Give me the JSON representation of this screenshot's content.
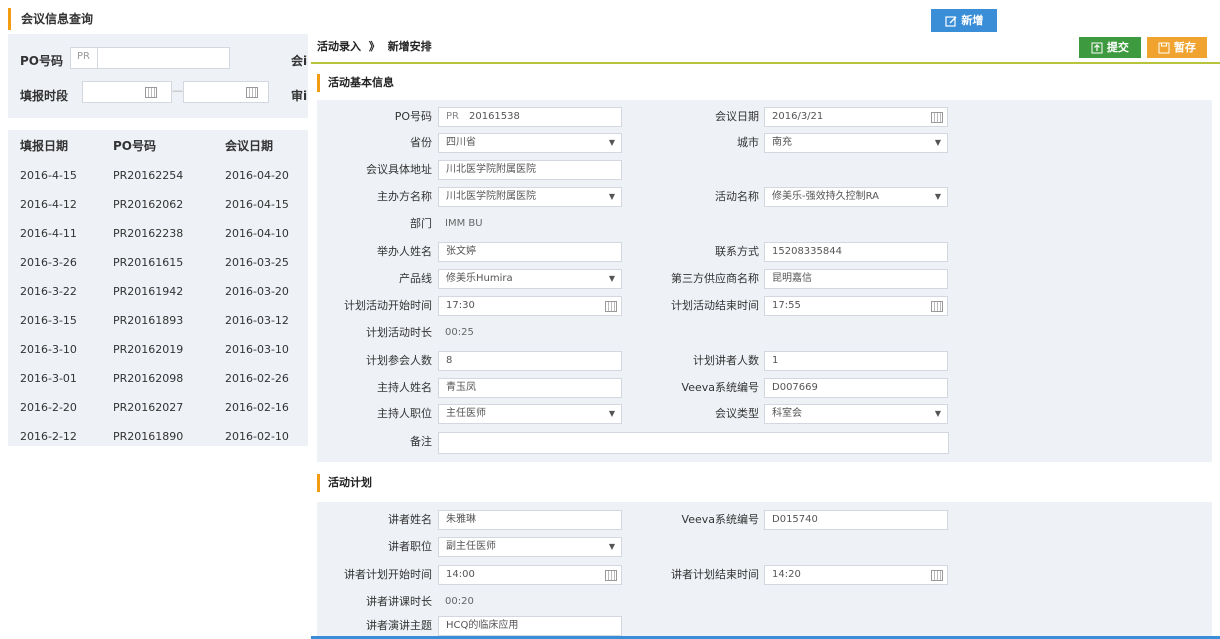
{
  "bg": {
    "title": "会议信息查询",
    "new_button": "新增",
    "filters": {
      "po_label": "PO号码",
      "po_prefix": "PR",
      "meeting_label_partial": "会i",
      "period_label": "填报时段",
      "review_label_partial": "审i",
      "date_sep": "—"
    },
    "table": {
      "headers": [
        "填报日期",
        "PO号码",
        "会议日期"
      ],
      "rows": [
        [
          "2016-4-15",
          "PR20162254",
          "2016-04-20"
        ],
        [
          "2016-4-12",
          "PR20162062",
          "2016-04-15"
        ],
        [
          "2016-4-11",
          "PR20162238",
          "2016-04-10"
        ],
        [
          "2016-3-26",
          "PR20161615",
          "2016-03-25"
        ],
        [
          "2016-3-22",
          "PR20161942",
          "2016-03-20"
        ],
        [
          "2016-3-15",
          "PR20161893",
          "2016-03-12"
        ],
        [
          "2016-3-10",
          "PR20162019",
          "2016-03-10"
        ],
        [
          "2016-3-01",
          "PR20162098",
          "2016-02-26"
        ],
        [
          "2016-2-20",
          "PR20162027",
          "2016-02-16"
        ],
        [
          "2016-2-12",
          "PR20161890",
          "2016-02-10"
        ]
      ]
    }
  },
  "fg": {
    "breadcrumb_root": "活动录入",
    "breadcrumb_sep": "》",
    "breadcrumb_current": "新增安排",
    "submit_label": "提交",
    "save_label": "暂存",
    "section1_title": "活动基本信息",
    "section2_title": "活动计划",
    "basic": {
      "po_label": "PO号码",
      "po_prefix": "PR",
      "po_value": "20161538",
      "meeting_date_label": "会议日期",
      "meeting_date_value": "2016/3/21",
      "province_label": "省份",
      "province_value": "四川省",
      "city_label": "城市",
      "city_value": "南充",
      "address_label": "会议具体地址",
      "address_value": "川北医学院附属医院",
      "host_org_label": "主办方名称",
      "host_org_value": "川北医学院附属医院",
      "activity_name_label": "活动名称",
      "activity_name_value": "修美乐-强效持久控制RA",
      "dept_label": "部门",
      "dept_value": "IMM BU",
      "organizer_label": "举办人姓名",
      "organizer_value": "张文婷",
      "contact_label": "联系方式",
      "contact_value": "15208335844",
      "product_label": "产品线",
      "product_value": "修美乐Humira",
      "vendor_label": "第三方供应商名称",
      "vendor_value": "昆明嘉信",
      "start_label": "计划活动开始时间",
      "start_value": "17:30",
      "end_label": "计划活动结束时间",
      "end_value": "17:55",
      "duration_label": "计划活动时长",
      "duration_value": "00:25",
      "attendees_label": "计划参会人数",
      "attendees_value": "8",
      "speakers_label": "计划讲者人数",
      "speakers_value": "1",
      "moderator_label": "主持人姓名",
      "moderator_value": "青玉凤",
      "veeva_label": "Veeva系统编号",
      "veeva_value": "D007669",
      "moderator_title_label": "主持人职位",
      "moderator_title_value": "主任医师",
      "meeting_type_label": "会议类型",
      "meeting_type_value": "科室会",
      "remarks_label": "备注",
      "remarks_value": ""
    },
    "plan": {
      "speaker_label": "讲者姓名",
      "speaker_value": "朱雅琳",
      "veeva_label": "Veeva系统编号",
      "veeva_value": "D015740",
      "speaker_title_label": "讲者职位",
      "speaker_title_value": "副主任医师",
      "start_label": "讲者计划开始时间",
      "start_value": "14:00",
      "end_label": "讲者计划结束时间",
      "end_value": "14:20",
      "duration_label": "讲者讲课时长",
      "duration_value": "00:20",
      "topic_label": "讲者演讲主题",
      "topic_value": "HCQ的临床应用"
    }
  }
}
